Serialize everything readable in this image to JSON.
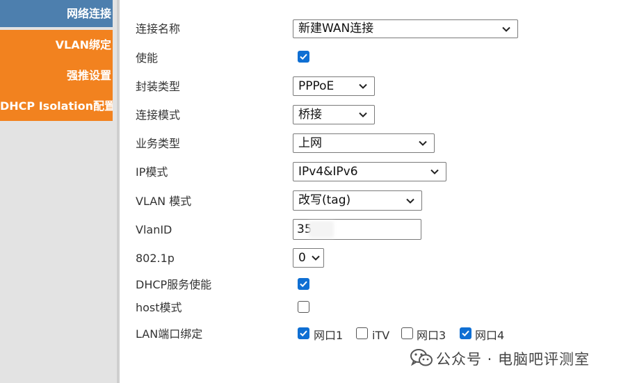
{
  "sidebar": {
    "items": [
      {
        "label": "网络连接"
      },
      {
        "label": "VLAN绑定"
      },
      {
        "label": "强推设置"
      },
      {
        "label": "DHCP Isolation配置"
      }
    ]
  },
  "form": {
    "connection_name": {
      "label": "连接名称",
      "value": "新建WAN连接"
    },
    "enable": {
      "label": "使能",
      "checked": true
    },
    "encapsulation": {
      "label": "封装类型",
      "value": "PPPoE"
    },
    "connection_mode": {
      "label": "连接模式",
      "value": "桥接"
    },
    "service_type": {
      "label": "业务类型",
      "value": "上网"
    },
    "ip_mode": {
      "label": "IP模式",
      "value": "IPv4&IPv6"
    },
    "vlan_mode": {
      "label": "VLAN 模式",
      "value": "改写(tag)"
    },
    "vlan_id": {
      "label": "VlanID",
      "value": "35"
    },
    "priority": {
      "label": "802.1p",
      "value": "0"
    },
    "dhcp_service": {
      "label": "DHCP服务使能",
      "checked": true
    },
    "host_mode": {
      "label": "host模式",
      "checked": false
    },
    "lan_binding": {
      "label": "LAN端口绑定",
      "ports": [
        {
          "label": "网口1",
          "checked": true
        },
        {
          "label": "iTV",
          "checked": false
        },
        {
          "label": "网口3",
          "checked": false
        },
        {
          "label": "网口4",
          "checked": true
        }
      ]
    }
  },
  "watermark": {
    "text": "公众号 · 电脑吧评测室",
    "icon": "wechat-icon"
  },
  "colors": {
    "sidebar_active": "#4d7fae",
    "sidebar_item": "#f2821f",
    "sidebar_bg": "#e3e3e3",
    "checkbox_checked": "#0f6fd3"
  }
}
